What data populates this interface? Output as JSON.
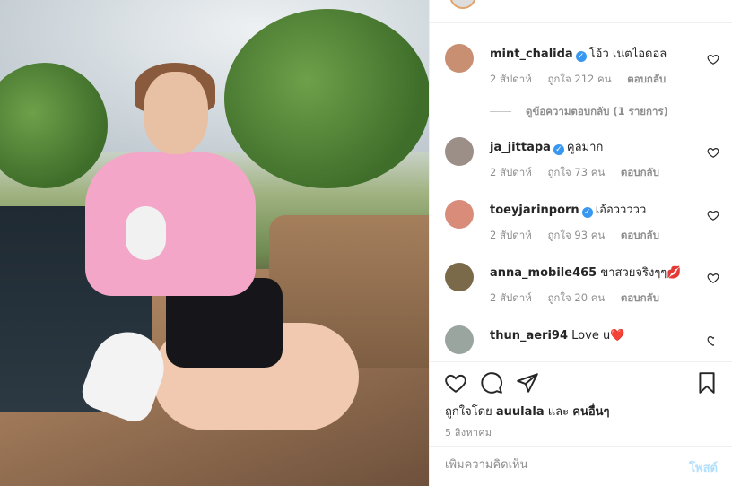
{
  "comments": [
    {
      "username": "mint_chalida",
      "verified": true,
      "text": "โอ้ว เนตไอดอล",
      "time": "2 สัปดาห์",
      "likes": "ถูกใจ 212 คน",
      "reply": "ตอบกลับ",
      "avatar_color": "#c98f72"
    },
    {
      "username": "ja_jittapa",
      "verified": true,
      "text": "คูลมาก",
      "time": "2 สัปดาห์",
      "likes": "ถูกใจ 73 คน",
      "reply": "ตอบกลับ",
      "avatar_color": "#9b8f88"
    },
    {
      "username": "toeyjarinporn",
      "verified": true,
      "text": "เอ้อววววว",
      "time": "2 สัปดาห์",
      "likes": "ถูกใจ 93 คน",
      "reply": "ตอบกลับ",
      "avatar_color": "#d98c7a"
    },
    {
      "username": "anna_mobile465",
      "verified": false,
      "text": "ขาสวยจริงๆๆ💋",
      "time": "2 สัปดาห์",
      "likes": "ถูกใจ 20 คน",
      "reply": "ตอบกลับ",
      "avatar_color": "#7a6a4a"
    },
    {
      "username": "thun_aeri94",
      "verified": false,
      "text": "Love u❤️",
      "avatar_color": "#9aa5a0"
    }
  ],
  "view_replies": "ดูข้อความตอบกลับ (1 รายการ)",
  "liked_by": {
    "prefix": "ถูกใจโดย",
    "user": "auulala",
    "and": "และ",
    "others": "คนอื่นๆ"
  },
  "post_date": "5 สิงหาคม",
  "comment_box": {
    "placeholder": "เพิ่มความคิดเห็น",
    "post_label": "โพสต์"
  },
  "colors": {
    "verified": "#3897f0",
    "muted": "#8e8e8e",
    "post_disabled": "#b2dffc"
  },
  "icons": {
    "like": "heart-icon",
    "comment": "comment-icon",
    "share": "share-icon",
    "save": "bookmark-icon"
  }
}
